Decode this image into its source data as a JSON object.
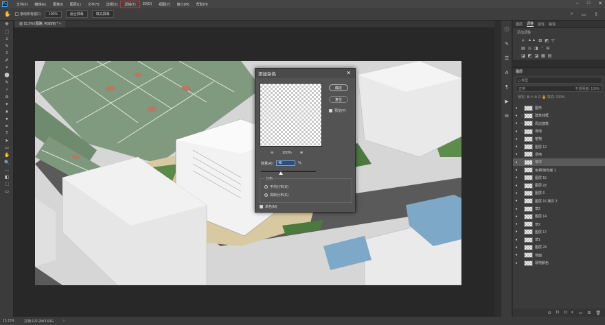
{
  "menubar": {
    "logo": "Ps",
    "items": [
      "文件(F)",
      "编辑(E)",
      "图像(I)",
      "图层(L)",
      "文字(Y)",
      "选择(S)",
      "滤镜(T)",
      "3D(D)",
      "视图(V)",
      "窗口(W)",
      "帮助(H)"
    ],
    "highlighted_index": 6,
    "window_controls": [
      "–",
      "□",
      "✕"
    ]
  },
  "optbar": {
    "tool_icon": "✋",
    "scroll_all": "滚动所有窗口",
    "zoom": "100%",
    "fit_screen": "适合屏幕",
    "fill_screen": "填充屏幕",
    "right_icons": [
      "⌕",
      "▭",
      "⇪"
    ]
  },
  "document_tab": {
    "label": "@ 15.2% (图路, RGB/8) * ×"
  },
  "tools": [
    "✥",
    "⬚",
    "ↄ",
    "✎",
    "⌗",
    "✐",
    "⌖",
    "⬤",
    "✎",
    "♁",
    "⊘",
    "✦",
    "▲",
    "●",
    "✒",
    "T",
    "➤",
    "▭",
    "✋",
    "🔍",
    "…",
    "◧",
    "⬚",
    "▭"
  ],
  "status": {
    "zoom": "15.15%",
    "doc": "文档:122.2M/3.63G",
    "arrow": "›"
  },
  "panel": {
    "tabs": [
      "图层",
      "调整",
      "属性",
      "路径"
    ],
    "active_tab": 1,
    "adj_title": "添加调整",
    "adj_rows": [
      [
        "☀",
        "▲▲",
        "⊠",
        "◩",
        "▽"
      ],
      [
        "▤",
        "◎",
        "◨",
        "◔",
        "⊞"
      ],
      [
        "◪",
        "◩",
        "◪",
        "▦",
        "▤"
      ]
    ]
  },
  "layers_panel": {
    "title": "图层",
    "filter": "ρ 类型",
    "blend": "正常",
    "opacity": "不透明度: 100%",
    "lock": "锁定: ⊠ ✐ ⊕ ⊡ 🔒   填充: 100%",
    "layers": [
      {
        "name": "图形"
      },
      {
        "name": "建筑线框"
      },
      {
        "name": "周边建筑"
      },
      {
        "name": "场地"
      },
      {
        "name": "植物"
      },
      {
        "name": "图层 12"
      },
      {
        "name": "场地"
      },
      {
        "name": "草坪"
      },
      {
        "name": "色相/饱和度 1"
      },
      {
        "name": "图层 15"
      },
      {
        "name": "图层 22"
      },
      {
        "name": "图层 6"
      },
      {
        "name": "图层 16 拷贝 3"
      },
      {
        "name": "草2"
      },
      {
        "name": "图层 14"
      },
      {
        "name": "草2"
      },
      {
        "name": "图层 17"
      },
      {
        "name": "草1"
      },
      {
        "name": "图层 24"
      },
      {
        "name": "地面"
      },
      {
        "name": "场地颜色"
      }
    ],
    "footer_icons": [
      "⊖",
      "fx",
      "◘",
      "◐",
      "▭",
      "⊞",
      "🗑"
    ]
  },
  "dialog": {
    "title": "添加杂色",
    "close": "✕",
    "ok": "确定",
    "reset": "复位",
    "preview_label": "预览(P)",
    "zoom_out": "⊖",
    "zoom": "100%",
    "zoom_in": "⊕",
    "amount_label": "数量(A):",
    "amount": "40",
    "pct": "%",
    "distribution": "分布",
    "uniform": "平均分布(U)",
    "gaussian": "高斯分布(G)",
    "mono": "单色(M)"
  }
}
